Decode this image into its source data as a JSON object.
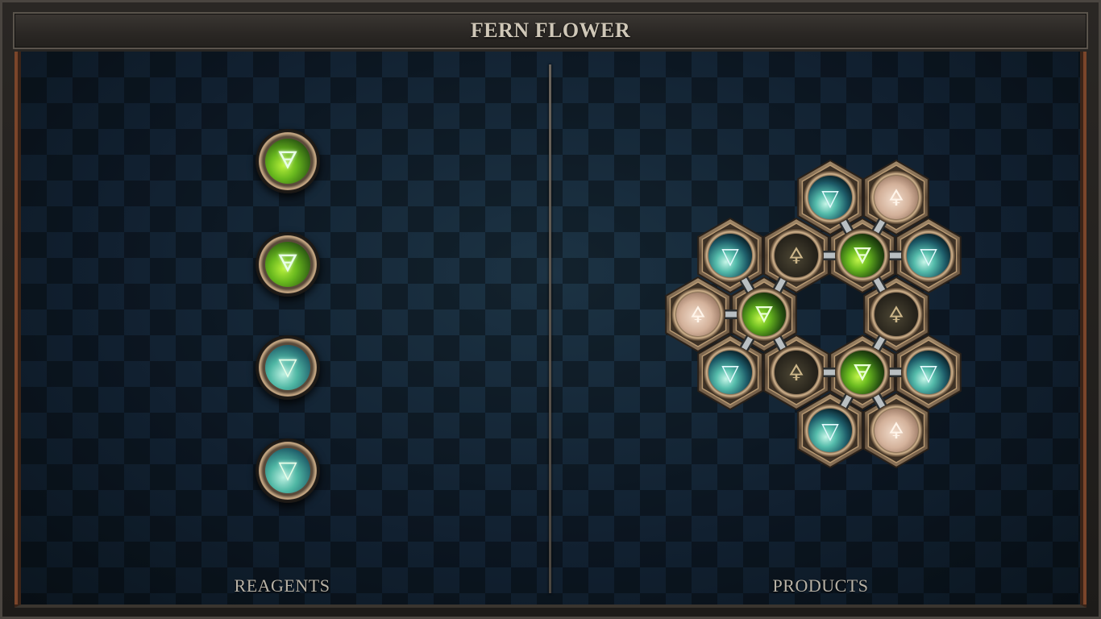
{
  "window": {
    "title": "FERN FLOWER"
  },
  "reagents": {
    "label": "REAGENTS",
    "items": [
      {
        "color": "green",
        "icon": "earth-alchemical-icon",
        "glyph": "🜃"
      },
      {
        "color": "green",
        "icon": "earth-alchemical-icon",
        "glyph": "🜃"
      },
      {
        "color": "teal",
        "icon": "water-alchemical-icon",
        "glyph": "▽"
      },
      {
        "color": "teal",
        "icon": "water-alchemical-icon",
        "glyph": "▽"
      }
    ]
  },
  "products": {
    "label": "PRODUCTS",
    "nodes": [
      {
        "type": "water",
        "icon": "water-alchemical-icon"
      },
      {
        "type": "sulfur-light",
        "icon": "sulfur-alchemical-icon"
      },
      {
        "type": "water",
        "icon": "water-alchemical-icon"
      },
      {
        "type": "salt-dark",
        "icon": "brimstone-alchemical-icon"
      },
      {
        "type": "earth",
        "icon": "earth-alchemical-icon"
      },
      {
        "type": "water",
        "icon": "water-alchemical-icon"
      },
      {
        "type": "sulfur-light",
        "icon": "sulfur-alchemical-icon"
      },
      {
        "type": "earth",
        "icon": "earth-alchemical-icon"
      },
      {
        "type": "salt-dark",
        "icon": "brimstone-alchemical-icon"
      },
      {
        "type": "water",
        "icon": "water-alchemical-icon"
      },
      {
        "type": "salt-dark",
        "icon": "brimstone-alchemical-icon"
      },
      {
        "type": "earth",
        "icon": "earth-alchemical-icon"
      },
      {
        "type": "water",
        "icon": "water-alchemical-icon"
      },
      {
        "type": "water",
        "icon": "water-alchemical-icon"
      },
      {
        "type": "sulfur-light",
        "icon": "sulfur-alchemical-icon"
      }
    ]
  },
  "colors": {
    "green_orb": "#68b81e",
    "teal_orb": "#4fb7a4",
    "light_orb": "#d9b9a3",
    "dark_orb": "#3a3528",
    "bronze": "#8a7258"
  }
}
